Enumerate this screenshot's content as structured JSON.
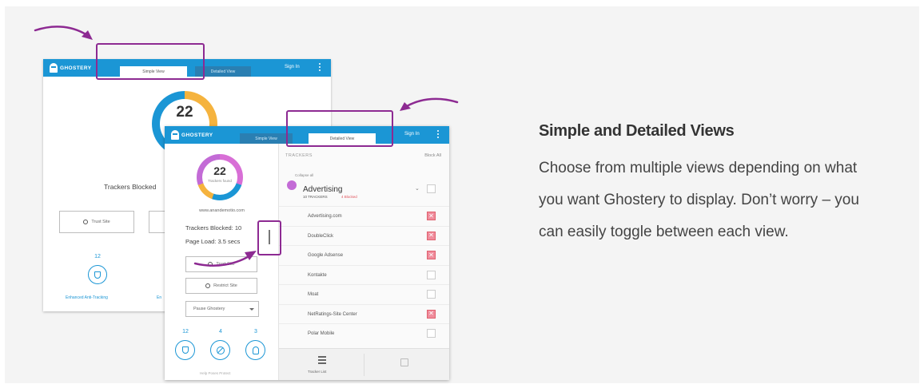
{
  "ui": {
    "logo_text": "GHOSTERY",
    "tab_simple": "Simple View",
    "tab_detailed": "Detailed View",
    "sign_in": "Sign In"
  },
  "back_panel": {
    "tracker_count": "22",
    "trackers_blocked": "Trackers Blocked",
    "trust_site": "Trust Site",
    "stat_number": "12",
    "feature_label": "Enhanced Anti-Tracking",
    "feature_label_2": "En"
  },
  "front_panel": {
    "tracker_count": "22",
    "donut_sub": "Trackers found",
    "site_url": "www.anandemotio.com",
    "trackers_blocked": "Trackers Blocked: 10",
    "page_load": "Page Load: 3.5 secs",
    "trust_site": "Trust Site",
    "restrict_site": "Restrict Site",
    "pause": "Pause Ghostery",
    "stats": [
      "12",
      "4",
      "3"
    ],
    "caption": "Help Poses Protect",
    "trackers_header": "TRACKERS",
    "block_all": "Block All",
    "collapse_all": "Collapse all",
    "category": {
      "name": "Advertising",
      "count": "10 TRACKERS",
      "blocked": "4 Blocked"
    },
    "trackers": [
      {
        "name": "Advertising.com",
        "blocked": true
      },
      {
        "name": "DoubleClick",
        "blocked": true
      },
      {
        "name": "Google Adsense",
        "blocked": true
      },
      {
        "name": "Kontakte",
        "blocked": false
      },
      {
        "name": "Moat",
        "blocked": false
      },
      {
        "name": "NetRatings-Site Center",
        "blocked": true
      },
      {
        "name": "Polar Mobile",
        "blocked": false
      }
    ],
    "tracker_list": "Tracker List"
  },
  "text": {
    "heading": "Simple and Detailed Views",
    "body": "Choose from multiple views depending on what you want Ghostery to display. Don’t worry – you can easily toggle between each view."
  },
  "colors": {
    "brand_blue": "#1b96d5",
    "highlight_purple": "#8d2a92",
    "blocked_red": "#e0525b"
  }
}
